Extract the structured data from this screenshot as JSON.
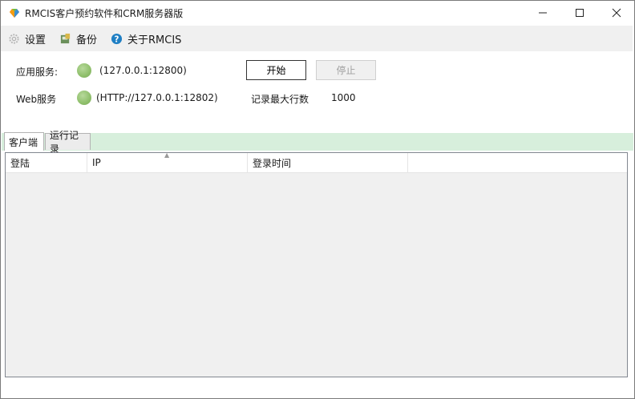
{
  "window": {
    "title": "RMCIS客户预约软件和CRM服务器版"
  },
  "menu": {
    "items": [
      {
        "label": "设置",
        "icon": "gear-icon"
      },
      {
        "label": "备份",
        "icon": "backup-icon"
      },
      {
        "label": "关于RMCIS",
        "icon": "help-icon"
      }
    ]
  },
  "app_service": {
    "label": "应用服务:",
    "address": "(127.0.0.1:12800)"
  },
  "web_service": {
    "label": "Web服务",
    "address": "(HTTP://127.0.0.1:12802)"
  },
  "buttons": {
    "start": "开始",
    "stop": "停止"
  },
  "max_rows": {
    "label": "记录最大行数",
    "value": "1000"
  },
  "tabs": [
    {
      "label": "客户端"
    },
    {
      "label": "运行记录"
    }
  ],
  "table": {
    "columns": [
      "登陆",
      "IP",
      "登录时间",
      ""
    ]
  },
  "colors": {
    "led": "#8fbf6b",
    "tabstrip": "#d7efdc"
  }
}
